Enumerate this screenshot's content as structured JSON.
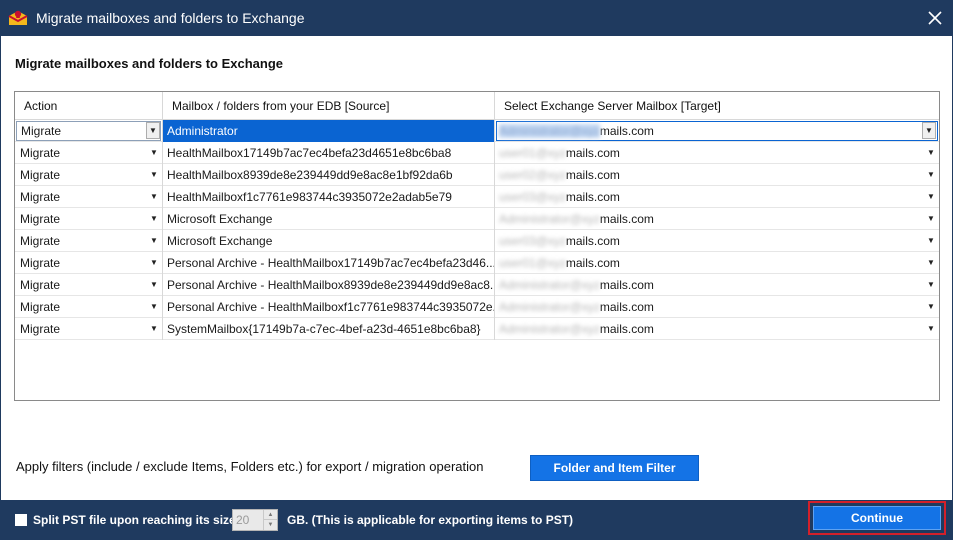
{
  "window": {
    "title": "Migrate mailboxes and folders to Exchange",
    "app_icon": "app-logo-icon",
    "close_icon": "close-icon"
  },
  "heading": "Migrate mailboxes and folders to Exchange",
  "table": {
    "columns": [
      "Action",
      "Mailbox / folders from your EDB [Source]",
      "Select Exchange Server Mailbox [Target]"
    ],
    "rows": [
      {
        "action": "Migrate",
        "source": "Administrator",
        "target_hidden": "Administrator@xyz",
        "target_domain": "mails.com"
      },
      {
        "action": "Migrate",
        "source": "HealthMailbox17149b7ac7ec4befa23d4651e8bc6ba8",
        "target_hidden": "user01@xyz",
        "target_domain": "mails.com"
      },
      {
        "action": "Migrate",
        "source": "HealthMailbox8939de8e239449dd9e8ac8e1bf92da6b",
        "target_hidden": "user02@xyz",
        "target_domain": "mails.com"
      },
      {
        "action": "Migrate",
        "source": "HealthMailboxf1c7761e983744c3935072e2adab5e79",
        "target_hidden": "user03@xyz",
        "target_domain": "mails.com"
      },
      {
        "action": "Migrate",
        "source": "Microsoft Exchange",
        "target_hidden": "Administrator@xyz",
        "target_domain": "mails.com"
      },
      {
        "action": "Migrate",
        "source": "Microsoft Exchange",
        "target_hidden": "user03@xyz",
        "target_domain": "mails.com"
      },
      {
        "action": "Migrate",
        "source": "Personal Archive - HealthMailbox17149b7ac7ec4befa23d46...",
        "target_hidden": "user01@xyz",
        "target_domain": "mails.com"
      },
      {
        "action": "Migrate",
        "source": "Personal Archive - HealthMailbox8939de8e239449dd9e8ac8...",
        "target_hidden": "Administrator@xyz",
        "target_domain": "mails.com"
      },
      {
        "action": "Migrate",
        "source": "Personal Archive - HealthMailboxf1c7761e983744c3935072e...",
        "target_hidden": "Administrator@xyz",
        "target_domain": "mails.com"
      },
      {
        "action": "Migrate",
        "source": "SystemMailbox{17149b7a-c7ec-4bef-a23d-4651e8bc6ba8}",
        "target_hidden": "Administrator@xyz",
        "target_domain": "mails.com"
      }
    ],
    "selected_row": 0
  },
  "filter": {
    "label": "Apply filters (include / exclude Items, Folders etc.) for export / migration operation",
    "button_label": "Folder and Item Filter"
  },
  "footer": {
    "split_label": "Split PST file upon reaching its size",
    "split_checked": false,
    "split_size": "20",
    "gb_label": "GB. (This is applicable for exporting items to PST)",
    "continue_label": "Continue"
  }
}
